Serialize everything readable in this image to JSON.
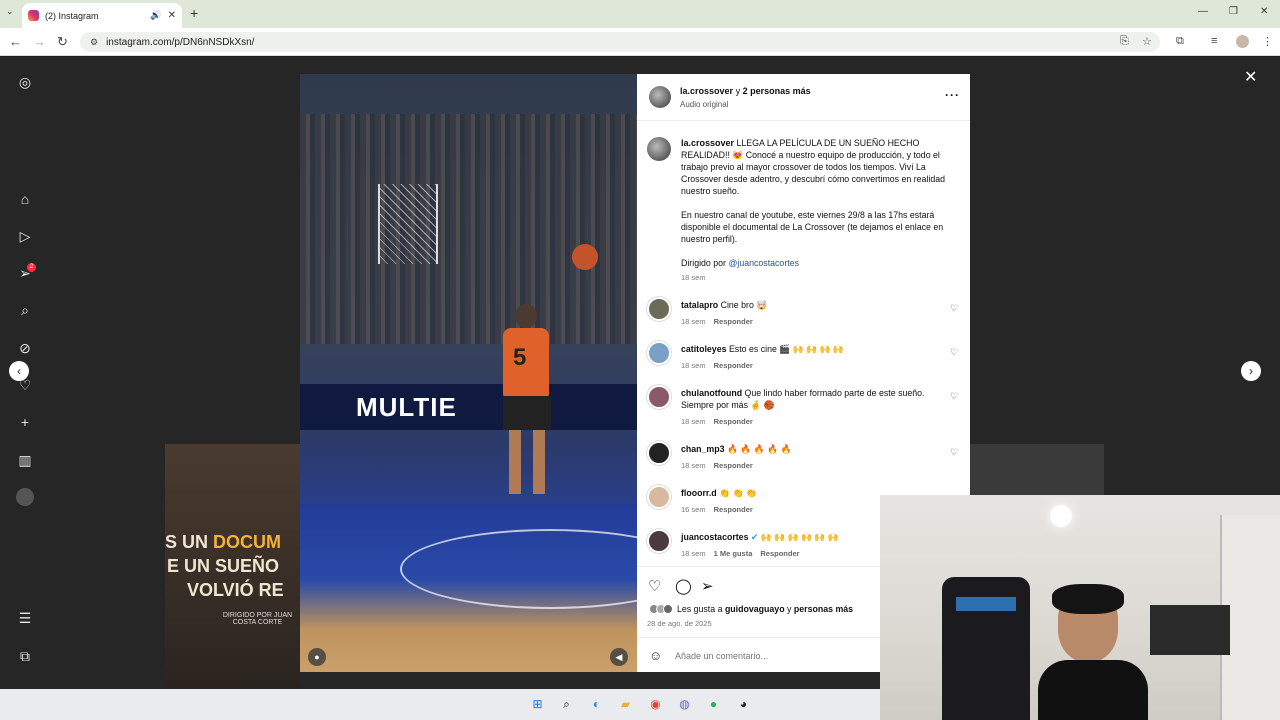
{
  "browser": {
    "tab_title": "(2) Instagram",
    "url": "instagram.com/p/DN6nNSDkXsn/"
  },
  "post": {
    "author": "la.crossover",
    "and_more": "y",
    "and_more_bold": "2 personas más",
    "audio": "Audio original",
    "caption_user": "la.crossover",
    "caption_p1": "LLEGA LA PELÍCULA DE UN SUEÑO HECHO REALIDAD!! 😻 Conocé a nuestro equipo de producción, y todo el trabajo previo al mayor crossover de todos los tiempos. Viví La Crossover desde adentro, y descubrí cómo convertimos en realidad nuestro sueño.",
    "caption_p2": "En nuestro canal de youtube, este viernes 29/8 a las 17hs estará disponible el documental de La Crossover (te dejamos el enlace en nuestro perfil).",
    "caption_p3_prefix": "Dirigido por",
    "caption_p3_link": "@juancostacortes",
    "caption_time": "18 sem"
  },
  "comments": [
    {
      "user": "tatalapro",
      "text": "Cine bro 🤯",
      "time": "18 sem",
      "reply": "Responder",
      "likes": ""
    },
    {
      "user": "catitoleyes",
      "text": "Esto es cine 🎬 🙌 🙌 🙌 🙌",
      "time": "18 sem",
      "reply": "Responder",
      "likes": ""
    },
    {
      "user": "chulanotfound",
      "text": "Que lindo haber formado parte de este sueño. Siempre por más 🤞 🏀",
      "time": "18 sem",
      "reply": "Responder",
      "likes": ""
    },
    {
      "user": "chan_mp3",
      "text": "🔥 🔥 🔥 🔥 🔥",
      "time": "18 sem",
      "reply": "Responder",
      "likes": ""
    },
    {
      "user": "flooorr.d",
      "text": "👏 👏 👏",
      "time": "16 sem",
      "reply": "Responder",
      "likes": ""
    },
    {
      "user": "juancostacortes",
      "text": "🙌 🙌 🙌 🙌 🙌 🙌",
      "time": "18 sem",
      "reply": "Responder",
      "likes": "1 Me gusta"
    }
  ],
  "likes": {
    "prefix": "Les gusta a",
    "user": "guidovaguayo",
    "and": "y",
    "more": "personas más"
  },
  "date": "28 de ago. de 2025",
  "comment_placeholder": "Añade un comentario...",
  "video": {
    "board_text": "MULTIE",
    "jersey_number": "5",
    "bg_card_line1_a": "S UN",
    "bg_card_line1_b": "DOCUM",
    "bg_card_line2": "E UN SUEÑO",
    "bg_card_line3": "VOLVIÓ RE",
    "bg_card_small": "DIRIGIDO POR JUAN COSTA CORTE"
  },
  "sidebar_badge": "2",
  "icons": {
    "instagram": "instagram-logo-icon",
    "home": "home-icon",
    "reels": "reels-icon",
    "messages": "messages-icon",
    "search": "search-icon",
    "explore": "explore-icon",
    "notifications": "heart-icon",
    "create": "plus-icon",
    "dashboard": "dashboard-icon",
    "profile": "avatar",
    "menu": "menu-icon",
    "more": "apps-icon"
  },
  "colors": {
    "accent": "#2f4f9a",
    "badge": "#ff3040",
    "panel_bg": "#ffffff",
    "page_bg": "#262626"
  }
}
